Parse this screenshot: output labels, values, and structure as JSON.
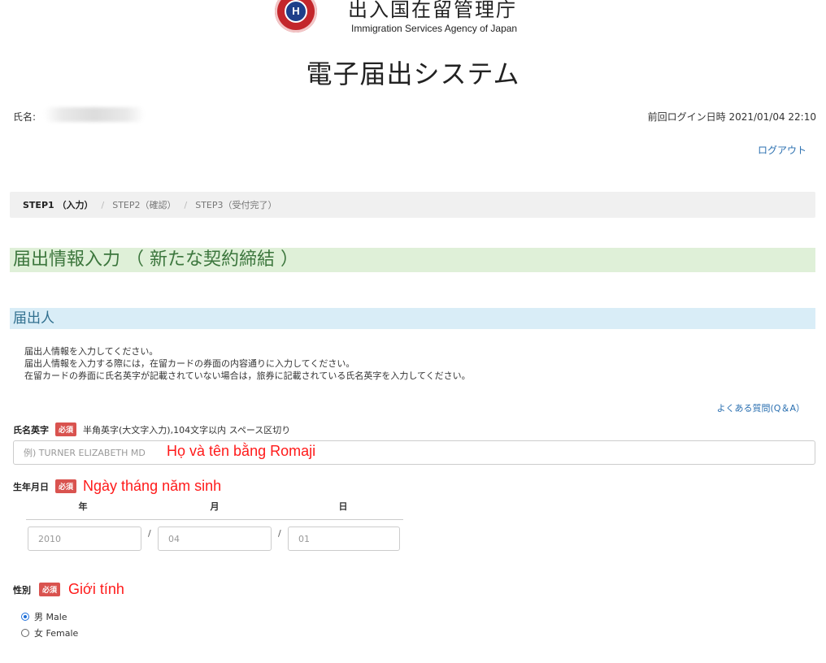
{
  "header": {
    "logo_letter": "H",
    "agency_ja": "出入国在留管理庁",
    "agency_en": "Immigration Services Agency of Japan",
    "system_title": "電子届出システム"
  },
  "user": {
    "name_label": "氏名:",
    "last_login_label": "前回ログイン日時",
    "last_login_value": "2021/01/04 22:10",
    "logout_label": "ログアウト"
  },
  "steps": [
    {
      "label": "STEP1 （入力）",
      "active": true
    },
    {
      "label": "STEP2（確認）",
      "active": false
    },
    {
      "label": "STEP3（受付完了）",
      "active": false
    }
  ],
  "form": {
    "title": "届出情報入力 （ 新たな契約締結 ）",
    "section_title": "届出人",
    "instructions": [
      "届出人情報を入力してください。",
      "届出人情報を入力する際には，在留カードの券面の内容通りに入力してください。",
      "在留カードの券面に氏名英字が記載されていない場合は，旅券に記載されている氏名英字を入力してください。"
    ],
    "faq_link": "よくある質問(Q＆A）",
    "required_badge": "必須",
    "name_field": {
      "label": "氏名英字",
      "hint": "半角英字(大文字入力),104文字以内 スペース区切り",
      "placeholder": "例) TURNER ELIZABETH MD",
      "annotation": "Họ và tên bằng Romaji"
    },
    "birth_field": {
      "label": "生年月日",
      "annotation": "Ngày tháng năm sinh",
      "year_label": "年",
      "month_label": "月",
      "day_label": "日",
      "separator": "/",
      "year_placeholder": "2010",
      "month_placeholder": "04",
      "day_placeholder": "01"
    },
    "gender_field": {
      "label": "性別",
      "annotation": "Giới tính",
      "options": [
        {
          "label": "男 Male",
          "checked": true
        },
        {
          "label": "女 Female",
          "checked": false
        }
      ]
    }
  },
  "colors": {
    "required_badge": "#d9534f",
    "annotation_text": "#ff1a1a",
    "link": "#2a6fb0",
    "form_title_bg": "#dff0d8",
    "section_title_bg": "#d9edf7",
    "radio_checked": "#1e6fd9"
  }
}
